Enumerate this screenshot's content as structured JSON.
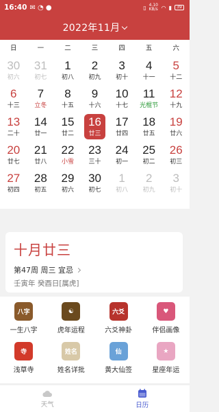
{
  "status_bar": {
    "time": "16:40",
    "net_speed": "4.10 KB/s",
    "battery": "39"
  },
  "header": {
    "title": "2022年11月"
  },
  "weekdays": [
    "日",
    "一",
    "二",
    "三",
    "四",
    "五",
    "六"
  ],
  "calendar": {
    "rows": [
      [
        {
          "d": "30",
          "l": "初六",
          "other": true
        },
        {
          "d": "31",
          "l": "初七",
          "other": true
        },
        {
          "d": "1",
          "l": "初八"
        },
        {
          "d": "2",
          "l": "初九"
        },
        {
          "d": "3",
          "l": "初十"
        },
        {
          "d": "4",
          "l": "十一"
        },
        {
          "d": "5",
          "l": "十二"
        }
      ],
      [
        {
          "d": "6",
          "l": "十三"
        },
        {
          "d": "7",
          "l": "立冬",
          "lc": "red"
        },
        {
          "d": "8",
          "l": "十五"
        },
        {
          "d": "9",
          "l": "十六"
        },
        {
          "d": "10",
          "l": "十七"
        },
        {
          "d": "11",
          "l": "光棍节",
          "lc": "green"
        },
        {
          "d": "12",
          "l": "十九"
        }
      ],
      [
        {
          "d": "13",
          "l": "二十"
        },
        {
          "d": "14",
          "l": "廿一"
        },
        {
          "d": "15",
          "l": "廿二"
        },
        {
          "d": "16",
          "l": "廿三",
          "today": true
        },
        {
          "d": "17",
          "l": "廿四"
        },
        {
          "d": "18",
          "l": "廿五"
        },
        {
          "d": "19",
          "l": "廿六"
        }
      ],
      [
        {
          "d": "20",
          "l": "廿七"
        },
        {
          "d": "21",
          "l": "廿八"
        },
        {
          "d": "22",
          "l": "小雪",
          "lc": "red"
        },
        {
          "d": "23",
          "l": "三十"
        },
        {
          "d": "24",
          "l": "初一"
        },
        {
          "d": "25",
          "l": "初二"
        },
        {
          "d": "26",
          "l": "初三"
        }
      ],
      [
        {
          "d": "27",
          "l": "初四"
        },
        {
          "d": "28",
          "l": "初五"
        },
        {
          "d": "29",
          "l": "初六"
        },
        {
          "d": "30",
          "l": "初七"
        },
        {
          "d": "1",
          "l": "初八",
          "other": true
        },
        {
          "d": "2",
          "l": "初九",
          "other": true
        },
        {
          "d": "3",
          "l": "初十",
          "other": true
        }
      ]
    ]
  },
  "info": {
    "lunar_date": "十月廿三",
    "week_line": "第47周 周三 宜忌",
    "ganzhi": "壬寅年 癸酉日[属虎]"
  },
  "apps": [
    [
      {
        "label": "一生八字",
        "icon": "bazi-icon",
        "glyph": "八字",
        "color": "#8a5a2b"
      },
      {
        "label": "虎年运程",
        "icon": "yinyang-icon",
        "glyph": "☯",
        "color": "#6b4a1e"
      },
      {
        "label": "六爻神卦",
        "icon": "liuyao-icon",
        "glyph": "六爻",
        "color": "#b7332c"
      },
      {
        "label": "伴侣画像",
        "icon": "partner-icon",
        "glyph": "♥",
        "color": "#d9577a"
      }
    ],
    [
      {
        "label": "浅草寺",
        "icon": "temple-icon",
        "glyph": "寺",
        "color": "#d23a2a"
      },
      {
        "label": "姓名详批",
        "icon": "name-icon",
        "glyph": "姓名",
        "color": "#d8c9a8"
      },
      {
        "label": "黄大仙签",
        "icon": "huangdaxian-icon",
        "glyph": "仙",
        "color": "#6aa2d8"
      },
      {
        "label": "星座年运",
        "icon": "zodiac-icon",
        "glyph": "★",
        "color": "#e9a6c2"
      }
    ]
  ],
  "tabs": [
    {
      "label": "天气",
      "icon": "weather-cloud-icon",
      "active": false
    },
    {
      "label": "日历",
      "icon": "calendar-icon",
      "active": true
    }
  ],
  "colors": {
    "accent": "#c8413f",
    "tab_active": "#4a5cd0"
  }
}
